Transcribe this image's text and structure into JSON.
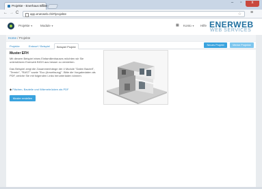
{
  "browser": {
    "tab_title": "Projekte - Enerhaus Bilder",
    "tab_close": "×",
    "url": "app.enerweb.ch/#/projekte",
    "controls": {
      "back": "←",
      "forward": "→",
      "reload": "C",
      "bookmark": "☆",
      "menu": "≡"
    },
    "window": {
      "minimize": "–",
      "maximize": "▫",
      "close": "x"
    }
  },
  "appbar": {
    "menu": [
      {
        "label": "Projekte"
      },
      {
        "label": "Module"
      }
    ],
    "right": {
      "grid_icon": "▦",
      "konto": "Konto",
      "hilfe": "Hilfe"
    },
    "brand": {
      "top": "ENERWEB",
      "bottom": "WEB SERVICES"
    }
  },
  "breadcrumb": {
    "home": "Home",
    "separator": " / ",
    "current": "Projekte"
  },
  "tabs": [
    {
      "label": "Projekte"
    },
    {
      "label": "Entwurf / Beispiel"
    },
    {
      "label": "Beispiel Projekt"
    }
  ],
  "buttons": {
    "neues_projekt": "Neues Projekt",
    "meine_projekte": "Meine Projekte",
    "oeffnen": "Muster erstellen"
  },
  "content": {
    "title": "Muster EFH",
    "paragraph1": "Mit diesem Beispiel eines Einfamilienhauses möchten wir Sie unterstützen Enerweb BIGH aus besser zu verstehen.",
    "paragraph2": "Das Beispiel zeigt die Zusammenhänge der 4 Module \"Daten Bauteil\", \"Termin\", \"RAST\" sowie \"Eco (Amortisung)\". Bitte die Vorgabedaten als PDF, welche Sie mit folgenden Links herunterladen können.",
    "pdf_link": "Flächen, Bauteile und Wärmebrücken als PDF",
    "pdf_bullet": "◆"
  },
  "colors": {
    "accent": "#3aa3de",
    "link": "#2a88c8",
    "brand": "#1f6f9f",
    "close": "#c9483e"
  }
}
